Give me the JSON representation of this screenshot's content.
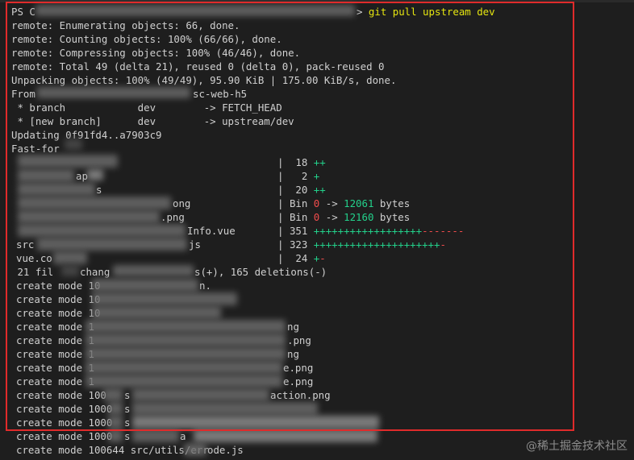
{
  "terminal": {
    "prompt_prefix": "PS C",
    "command": "git pull upstream dev",
    "lines": [
      "remote: Enumerating objects: 66, done.",
      "remote: Counting objects: 100% (66/66), done.",
      "remote: Compressing objects: 100% (46/46), done.",
      "remote: Total 49 (delta 21), reused 0 (delta 0), pack-reused 0",
      "Unpacking objects: 100% (49/49), 95.90 KiB | 175.00 KiB/s, done.",
      "From",
      "sc-web-h5",
      " * branch            dev        -> FETCH_HEAD",
      " * [new branch]      dev        -> upstream/dev",
      "Updating 0f91fd4..a7903c9",
      "Fast-for"
    ],
    "diffstat": [
      {
        "path": "",
        "sep": "|",
        "count": " 18",
        "plus": "++",
        "minus": "",
        "bin": ""
      },
      {
        "path": "ap",
        "sep": "|",
        "count": "  2",
        "plus": "+",
        "minus": "",
        "bin": ""
      },
      {
        "path": "s",
        "sep": "|",
        "count": " 20",
        "plus": "++",
        "minus": "",
        "bin": ""
      },
      {
        "path": "ong",
        "sep": "|",
        "count": "Bin",
        "bin_from": "0",
        "bin_arrow": "->",
        "bin_to": "12061",
        "bin_unit": "bytes"
      },
      {
        "path": ".png",
        "sep": "|",
        "count": "Bin",
        "bin_from": "0",
        "bin_arrow": "->",
        "bin_to": "12160",
        "bin_unit": "bytes"
      },
      {
        "path": "Info.vue",
        "sep": "|",
        "count": "351",
        "plus": "++++++++++++++++++",
        "minus": "-------"
      },
      {
        "path": "src",
        "path2": "js",
        "sep": "|",
        "count": "323",
        "plus": "+++++++++++++++++++++",
        "minus": "-"
      },
      {
        "path": "vue.co",
        "sep": "|",
        "count": " 24",
        "plus": "+",
        "minus": "-"
      }
    ],
    "summary_start": " 21 fil",
    "summary_mid": "chang",
    "summary_end": "s(+), 165 deletions(-)",
    "create_lines": [
      {
        "text": "create mode 10",
        "tail": "n."
      },
      {
        "text": "create mode 10",
        "tail": ""
      },
      {
        "text": "create mode 10",
        "tail": ""
      },
      {
        "text": "create mode 1",
        "tail": "ng"
      },
      {
        "text": "create mode 1",
        "tail": ".png"
      },
      {
        "text": "create mode 1",
        "tail": "ng"
      },
      {
        "text": "create mode 1",
        "tail": "e.png"
      },
      {
        "text": "create mode 1",
        "tail": "e.png"
      },
      {
        "text": "create mode 100",
        "mid": "s",
        "tail": "action.png"
      },
      {
        "text": "create mode 1000",
        "mid": "s",
        "tail": ""
      },
      {
        "text": "create mode 1000",
        "mid": "s",
        "tail": ""
      },
      {
        "text": "create mode 1000",
        "mid": "s",
        "tail": "a"
      },
      {
        "text": "create mode 100644 src/utils/err",
        "tail": "ode.js"
      }
    ]
  },
  "watermark": "@稀土掘金技术社区",
  "colors": {
    "background": "#1e1e1e",
    "text": "#d0d0d0",
    "command": "#e5e510",
    "insertions": "#23d18b",
    "deletions": "#f14c4c",
    "highlight_frame": "#e02b2b"
  }
}
